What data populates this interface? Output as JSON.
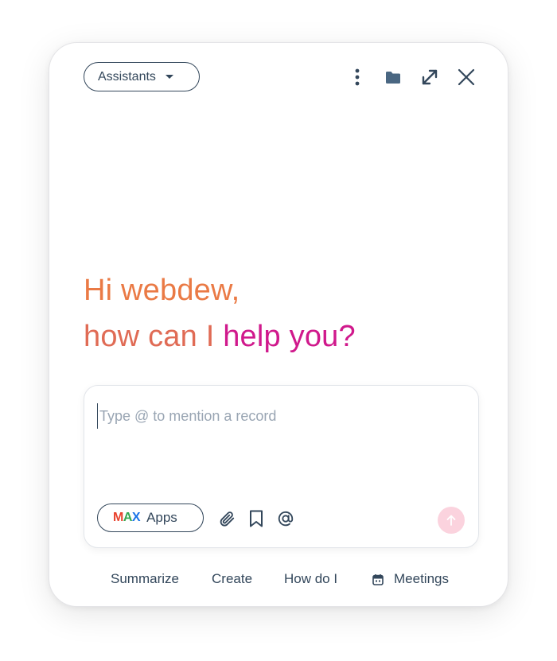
{
  "header": {
    "assistants_label": "Assistants",
    "icons": [
      "more-vertical-icon",
      "folder-icon",
      "expand-icon",
      "close-icon"
    ]
  },
  "greeting": {
    "line1": "Hi webdew,",
    "line2_part1": "how can I",
    "line2_part2": "help you?"
  },
  "composer": {
    "placeholder": "Type @ to mention a record",
    "value": "",
    "apps_label": "Apps",
    "apps_logo": {
      "m": "M",
      "a": "A",
      "x": "X"
    },
    "tool_icons": [
      "paperclip-icon",
      "bookmark-icon",
      "at-icon"
    ],
    "send_icon": "arrow-up-icon"
  },
  "suggestions": {
    "summarize": "Summarize",
    "create": "Create",
    "how_do_i": "How do I",
    "meetings": "Meetings"
  },
  "colors": {
    "text": "#33475b",
    "greeting_orange": "#ea7a45",
    "greeting_magenta": "#d0198c",
    "send_disabled": "#fbd3de",
    "logo_red": "#e8412c",
    "logo_green": "#34a853",
    "logo_blue": "#1a73e8"
  }
}
